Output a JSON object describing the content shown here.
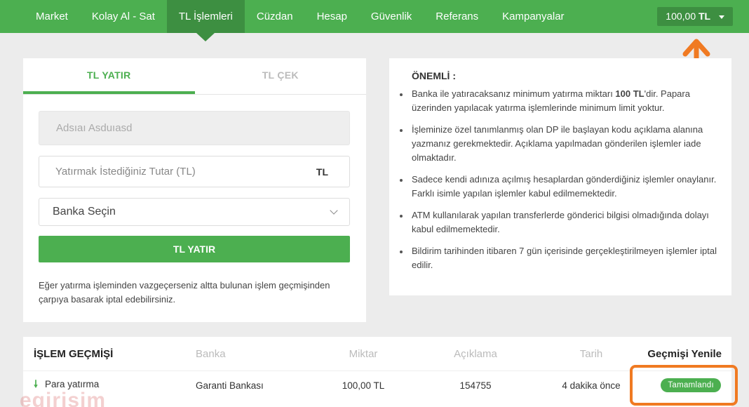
{
  "nav": {
    "items": [
      {
        "label": "Market"
      },
      {
        "label": "Kolay Al - Sat"
      },
      {
        "label": "TL İşlemleri"
      },
      {
        "label": "Cüzdan"
      },
      {
        "label": "Hesap"
      },
      {
        "label": "Güvenlik"
      },
      {
        "label": "Referans"
      },
      {
        "label": "Kampanyalar"
      }
    ],
    "active_index": 2,
    "balance_amount": "100,00",
    "balance_currency": "TL"
  },
  "deposit": {
    "tab_deposit": "TL YATIR",
    "tab_withdraw": "TL ÇEK",
    "name_value": "Adsıaı Asduıasd",
    "amount_placeholder": "Yatırmak İstediğiniz Tutar (TL)",
    "amount_unit": "TL",
    "bank_select": "Banka Seçin",
    "submit_label": "TL YATIR",
    "cancel_note": "Eğer yatırma işleminden vazgeçerseniz altta bulunan işlem geçmişinden çarpıya basarak iptal edebilirsiniz."
  },
  "info": {
    "title": "ÖNEMLİ :",
    "item1_pre": "Banka ile yatıracaksanız minimum yatırma miktarı ",
    "item1_bold": "100 TL",
    "item1_post": "'dir. Papara üzerinden yapılacak yatırma işlemlerinde minimum limit yoktur.",
    "item2": "İşleminize özel tanımlanmış olan DP ile başlayan kodu açıklama alanına yazmanız gerekmektedir. Açıklama yapılmadan gönderilen işlemler iade olmaktadır.",
    "item3": "Sadece kendi adınıza açılmış hesaplardan gönderdiğiniz işlemler onaylanır. Farklı isimle yapılan işlemler kabul edilmemektedir.",
    "item4": "ATM kullanılarak yapılan transferlerde gönderici bilgisi olmadığında dolayı kabul edilmemektedir.",
    "item5": "Bildirim tarihinden itibaren 7 gün içerisinde gerçekleştirilmeyen işlemler iptal edilir."
  },
  "history": {
    "title": "İŞLEM GEÇMİŞİ",
    "col_bank": "Banka",
    "col_amount": "Miktar",
    "col_desc": "Açıklama",
    "col_date": "Tarih",
    "refresh_label": "Geçmişi Yenile",
    "rows": [
      {
        "type": "Para yatırma",
        "bank": "Garanti Bankası",
        "amount": "100,00 TL",
        "desc": "154755",
        "date": "4 dakika önce",
        "status": "Tamamlandı"
      }
    ]
  },
  "watermark": "egirisim",
  "colors": {
    "brand_green": "#4caf50",
    "nav_active": "#3d8f41",
    "annotation_orange": "#f07a22"
  }
}
